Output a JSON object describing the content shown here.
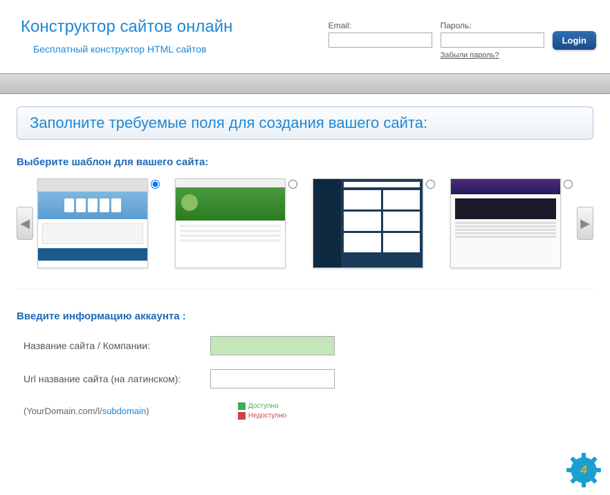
{
  "brand": {
    "title": "Конструктор сайтов онлайн",
    "subtitle": "Бесплатный конструктор HTML сайтов"
  },
  "login": {
    "email_label": "Email:",
    "password_label": "Пароль:",
    "forgot_label": "Забыли пароль?",
    "button_label": "Login"
  },
  "main": {
    "instruction": "Заполните требуемые поля для создания вашего сайта:",
    "template_heading": "Выберите шаблон для вашего сайта:",
    "account_heading": "Введите информацию аккаунта :",
    "site_name_label": "Название сайта / Компании:",
    "url_name_label": "Url название сайта (на латинском):",
    "domain_prefix": "(YourDomain.com/l/",
    "domain_sub": "subdomain",
    "domain_suffix": ")",
    "legend_available": "Доступно",
    "legend_unavailable": "Недоступно"
  }
}
